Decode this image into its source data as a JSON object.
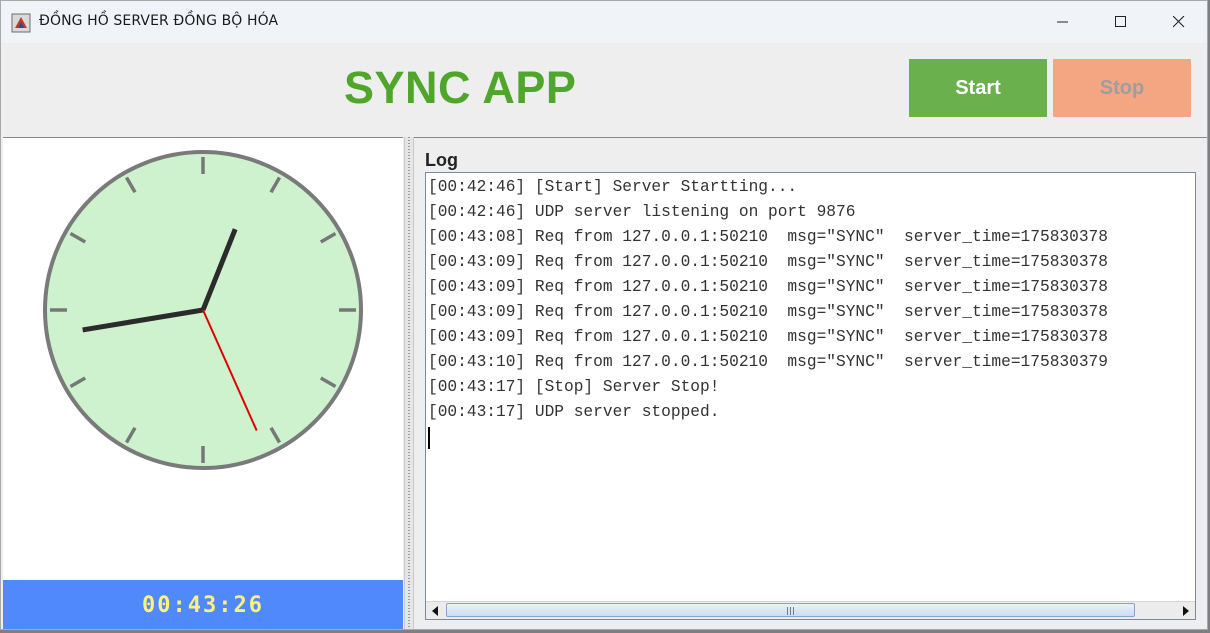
{
  "window": {
    "title": "ĐỒNG HỒ SERVER ĐỒNG BỘ HÓA",
    "app_icon": "java-cup-icon",
    "controls": [
      "minimize-icon",
      "maximize-icon",
      "close-icon"
    ]
  },
  "header": {
    "app_title": "SYNC APP",
    "start_label": "Start",
    "stop_label": "Stop",
    "start_enabled": true,
    "stop_enabled": false
  },
  "clock": {
    "digital_time": "00:43:26",
    "analog": {
      "hours": 0,
      "minutes": 43,
      "seconds": 26
    }
  },
  "log": {
    "label": "Log",
    "lines": [
      "[00:42:46] [Start] Server Startting...",
      "[00:42:46] UDP server listening on port 9876",
      "[00:43:08] Req from 127.0.0.1:50210  msg=\"SYNC\"  server_time=175830378",
      "[00:43:09] Req from 127.0.0.1:50210  msg=\"SYNC\"  server_time=175830378",
      "[00:43:09] Req from 127.0.0.1:50210  msg=\"SYNC\"  server_time=175830378",
      "[00:43:09] Req from 127.0.0.1:50210  msg=\"SYNC\"  server_time=175830378",
      "[00:43:09] Req from 127.0.0.1:50210  msg=\"SYNC\"  server_time=175830378",
      "[00:43:10] Req from 127.0.0.1:50210  msg=\"SYNC\"  server_time=175830379",
      "[00:43:17] [Stop] Server Stop!",
      "[00:43:17] UDP server stopped."
    ]
  },
  "colors": {
    "title_green": "#4fa62a",
    "start_bg": "#6ab04c",
    "stop_bg": "#f4a582",
    "clock_face": "#cdf2cd",
    "digital_bg": "#5089fc",
    "digital_text": "#fff27a",
    "second_hand": "#e00000"
  }
}
